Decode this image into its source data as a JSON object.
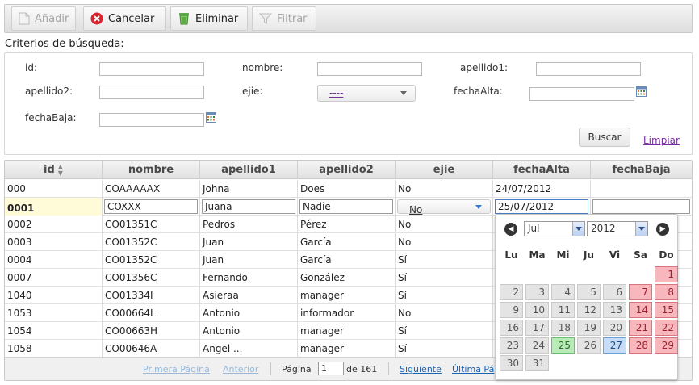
{
  "toolbar": {
    "add": "Añadir",
    "cancel": "Cancelar",
    "delete": "Eliminar",
    "filter": "Filtrar"
  },
  "search": {
    "title": "Criterios de búsqueda:",
    "labels": {
      "id": "id:",
      "nombre": "nombre:",
      "apellido1": "apellido1:",
      "apellido2": "apellido2:",
      "ejie": "ejie:",
      "fechaAlta": "fechaAlta:",
      "fechaBaja": "fechaBaja:"
    },
    "ejie_value": "----",
    "buscar": "Buscar",
    "limpiar": "Limpiar"
  },
  "grid": {
    "columns": [
      "id",
      "nombre",
      "apellido1",
      "apellido2",
      "ejie",
      "fechaAlta",
      "fechaBaja"
    ],
    "rows": [
      [
        "000",
        "COAAAAAX",
        "Johna",
        "Does",
        "No",
        "24/07/2012",
        ""
      ],
      [
        "0001",
        "COXXX",
        "Juana",
        "Nadie",
        "No",
        "25/07/2012",
        ""
      ],
      [
        "0002",
        "CO01351C",
        "Pedros",
        "Pérez",
        "No",
        "",
        ""
      ],
      [
        "0003",
        "CO01352C",
        "Juan",
        "García",
        "No",
        "",
        ""
      ],
      [
        "0004",
        "CO01352C",
        "Juan",
        "García",
        "Sí",
        "",
        ""
      ],
      [
        "0007",
        "CO01356C",
        "Fernando",
        "González",
        "Sí",
        "",
        ""
      ],
      [
        "1040",
        "CO01334I",
        "Asieraa",
        "manager",
        "Sí",
        "",
        ""
      ],
      [
        "1053",
        "CO00664L",
        "Antonio",
        "informador",
        "No",
        "",
        ""
      ],
      [
        "1054",
        "CO00663H",
        "Antonio",
        "manager",
        "Sí",
        "",
        ""
      ],
      [
        "1058",
        "CO00646A",
        "Angel ...",
        "manager",
        "Sí",
        "",
        ""
      ]
    ],
    "editing_row": 1
  },
  "pager": {
    "first": "Primera Página",
    "prev": "Anterior",
    "page_label": "Página",
    "page_value": "1",
    "of_label": "de 161",
    "next": "Siguiente",
    "last": "Última Pá"
  },
  "calendar": {
    "month": "Jul",
    "year": "2012",
    "weekdays": [
      "Lu",
      "Ma",
      "Mi",
      "Ju",
      "Vi",
      "Sa",
      "Do"
    ],
    "first_weekday_index": 6,
    "days_in_month": 31,
    "today": 25,
    "selected": 27,
    "colors": {
      "weekend": "#f7b7bc",
      "today": "#b8ebb8",
      "selected": "#c7dcf7",
      "normal": "#e4e4e4"
    }
  }
}
